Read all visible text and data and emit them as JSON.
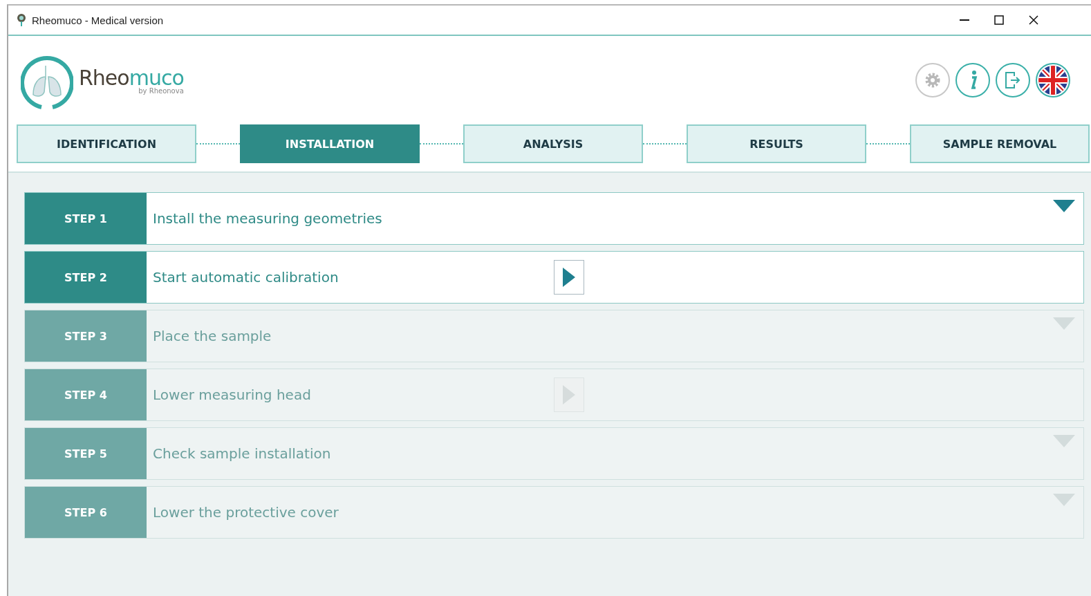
{
  "window": {
    "title": "Rheomuco - Medical version"
  },
  "logo": {
    "name_dark": "Rheo",
    "name_teal": "muco",
    "byline": "by Rheonova"
  },
  "tabs": [
    {
      "label": "IDENTIFICATION",
      "selected": false
    },
    {
      "label": "INSTALLATION",
      "selected": true
    },
    {
      "label": "ANALYSIS",
      "selected": false
    },
    {
      "label": "RESULTS",
      "selected": false
    },
    {
      "label": "SAMPLE REMOVAL",
      "selected": false
    }
  ],
  "steps": [
    {
      "label": "STEP 1",
      "text": "Install the measuring geometries",
      "kind": "expand",
      "disabled": false
    },
    {
      "label": "STEP 2",
      "text": "Start automatic calibration",
      "kind": "play",
      "disabled": false
    },
    {
      "label": "STEP 3",
      "text": "Place the sample",
      "kind": "expand",
      "disabled": true
    },
    {
      "label": "STEP 4",
      "text": "Lower measuring head",
      "kind": "play",
      "disabled": true
    },
    {
      "label": "STEP 5",
      "text": "Check sample installation",
      "kind": "expand",
      "disabled": true
    },
    {
      "label": "STEP 6",
      "text": "Lower the protective cover",
      "kind": "expand",
      "disabled": true
    }
  ]
}
